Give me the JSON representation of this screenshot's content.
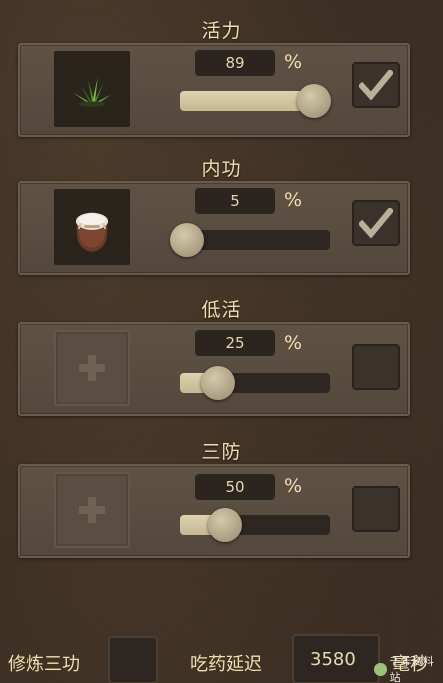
{
  "sections": [
    {
      "title": "活力",
      "value": "89",
      "percent_sign": "%",
      "level": 89,
      "checked": true,
      "slot": "grass-herb-icon"
    },
    {
      "title": "内功",
      "value": "5",
      "percent_sign": "%",
      "level": 5,
      "checked": true,
      "slot": "potion-jar-icon"
    },
    {
      "title": "低活",
      "value": "25",
      "percent_sign": "%",
      "level": 25,
      "checked": false,
      "slot": "empty-add-icon"
    },
    {
      "title": "三防",
      "value": "50",
      "percent_sign": "%",
      "level": 50,
      "checked": false,
      "slot": "empty-add-icon"
    }
  ],
  "bottom": {
    "train_label": "修炼三功",
    "delay_label": "吃药延迟",
    "delay_value": "3580",
    "delay_unit": "毫秒"
  },
  "watermark": "千年资料站",
  "colors": {
    "text": "#f0dfb2",
    "panel": "#5a4d40",
    "fill": "#d6c9a6"
  }
}
